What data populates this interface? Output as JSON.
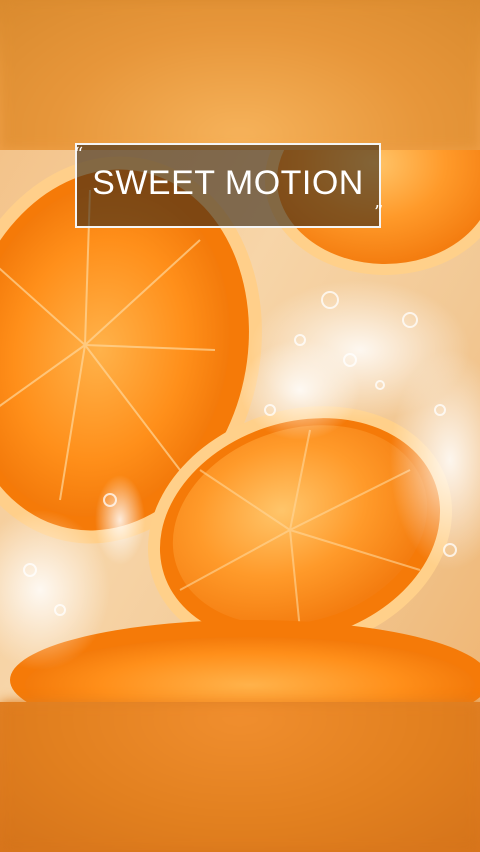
{
  "overlay": {
    "title": "SWEET MOTION",
    "quote_open": "“",
    "quote_close": "”"
  },
  "image": {
    "subject": "orange-slices-splash-image"
  },
  "colors": {
    "orange": "#f07d10",
    "background_blur": "#e8953a",
    "title_box_bg": "#372819",
    "title_border": "#f5f5f5"
  }
}
